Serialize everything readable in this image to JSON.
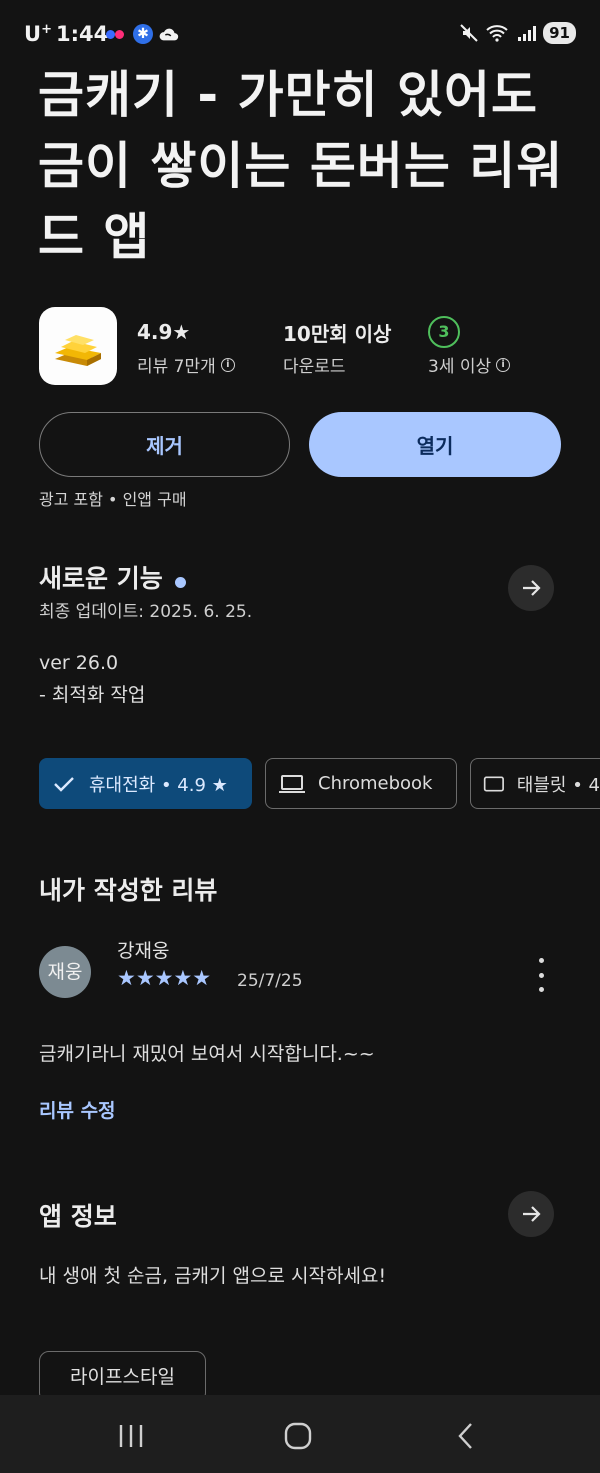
{
  "status_bar": {
    "carrier": "U",
    "carrier_sup": "+",
    "time": "1:44",
    "battery": "91"
  },
  "app": {
    "title": "금캐기 - 가만히 있어도 금이 쌓이는 돈버는 리워드 앱",
    "rating": "4.9★",
    "reviews_label": "리뷰 7만개",
    "downloads": "10만회 이상",
    "downloads_label": "다운로드",
    "age_badge": "3",
    "age_label": "3세 이상"
  },
  "actions": {
    "uninstall_label": "제거",
    "open_label": "열기",
    "ads_note": "광고 포함 • 인앱 구매"
  },
  "whats_new": {
    "title": "새로운 기능",
    "updated": "최종 업데이트: 2025. 6. 25.",
    "version": "ver 26.0",
    "notes": "- 최적화 작업"
  },
  "device_chips": [
    {
      "label": "휴대전화 • 4.9 ★",
      "icon": "check-icon",
      "active": true
    },
    {
      "label": "Chromebook",
      "icon": "laptop-icon",
      "active": false
    },
    {
      "label": "태블릿 • 4",
      "icon": "tablet-icon",
      "active": false
    }
  ],
  "my_review": {
    "title": "내가 작성한 리뷰",
    "avatar_text": "재웅",
    "reviewer": "강재웅",
    "stars": "★★★★★",
    "date": "25/7/25",
    "text": "금캐기라니 재밌어 보여서 시작합니다.~~",
    "edit_label": "리뷰 수정"
  },
  "about": {
    "title": "앱 정보",
    "description": "내 생애 첫 순금, 금캐기 앱으로 시작하세요!",
    "category": "라이프스타일"
  },
  "colors": {
    "background": "#131313",
    "accent": "#a9c7ff",
    "chip_active": "#0e4a7a",
    "age_green": "#4fbf5c"
  }
}
